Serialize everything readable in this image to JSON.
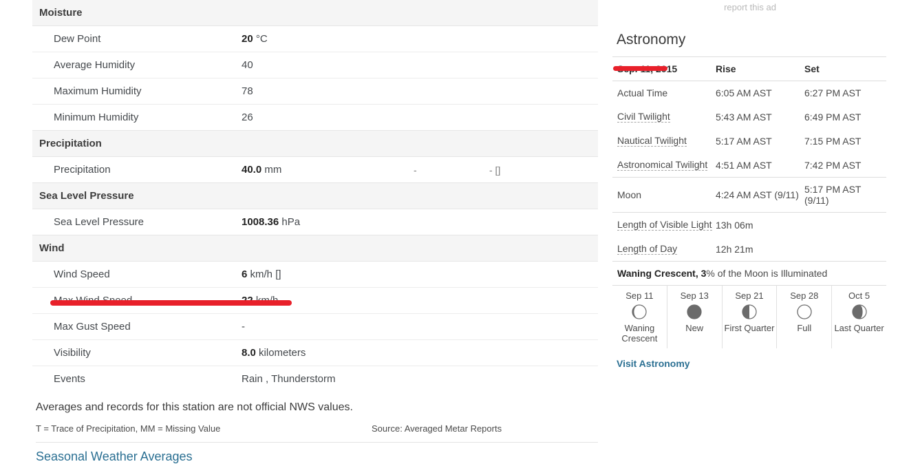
{
  "history": {
    "sections": [
      {
        "title": "Moisture",
        "rows": [
          {
            "label": "Dew Point",
            "num": "20",
            "unit": "°C",
            "x1": "",
            "x2": ""
          },
          {
            "label": "Average Humidity",
            "num": "",
            "unit": "40",
            "x1": "",
            "x2": ""
          },
          {
            "label": "Maximum Humidity",
            "num": "",
            "unit": "78",
            "x1": "",
            "x2": ""
          },
          {
            "label": "Minimum Humidity",
            "num": "",
            "unit": "26",
            "x1": "",
            "x2": ""
          }
        ]
      },
      {
        "title": "Precipitation",
        "rows": [
          {
            "label": "Precipitation",
            "num": "40.0",
            "unit": "mm",
            "x1": "-",
            "x2": "- []"
          }
        ]
      },
      {
        "title": "Sea Level Pressure",
        "rows": [
          {
            "label": "Sea Level Pressure",
            "num": "1008.36",
            "unit": "hPa",
            "x1": "",
            "x2": ""
          }
        ]
      },
      {
        "title": "Wind",
        "rows": [
          {
            "label": "Wind Speed",
            "num": "6",
            "unit": "km/h []",
            "x1": "",
            "x2": ""
          },
          {
            "label": "Max Wind Speed",
            "num": "22",
            "unit": "km/h",
            "x1": "",
            "x2": ""
          },
          {
            "label": "Max Gust Speed",
            "num": "",
            "unit": "-",
            "x1": "",
            "x2": ""
          },
          {
            "label": "Visibility",
            "num": "8.0",
            "unit": "kilometers",
            "x1": "",
            "x2": ""
          },
          {
            "label": "Events",
            "num": "",
            "unit": "Rain , Thunderstorm",
            "x1": "",
            "x2": ""
          }
        ]
      }
    ],
    "nws_note": "Averages and records for this station are not official NWS values.",
    "legend": "T = Trace of Precipitation, MM = Missing Value",
    "source": "Source: Averaged Metar Reports",
    "seasonal_link": "Seasonal Weather Averages"
  },
  "astronomy": {
    "report_ad": "report this ad",
    "title": "Astronomy",
    "columns": {
      "date": "Sep. 11, 2015",
      "rise": "Rise",
      "set": "Set"
    },
    "rows": [
      {
        "label": "Actual Time",
        "tip": false,
        "rise": "6:05 AM AST",
        "set": "6:27 PM AST"
      },
      {
        "label": "Civil Twilight",
        "tip": true,
        "rise": "5:43 AM AST",
        "set": "6:49 PM AST"
      },
      {
        "label": "Nautical Twilight",
        "tip": true,
        "rise": "5:17 AM AST",
        "set": "7:15 PM AST"
      },
      {
        "label": "Astronomical Twilight",
        "tip": true,
        "rise": "4:51 AM AST",
        "set": "7:42 PM AST"
      },
      {
        "label": "Moon",
        "tip": false,
        "rise": "4:24 AM AST (9/11)",
        "set": "5:17 PM AST (9/11)"
      },
      {
        "label": "Length of Visible Light",
        "tip": true,
        "rise": "13h 06m",
        "set": ""
      },
      {
        "label": "Length of Day",
        "tip": true,
        "rise": "12h 21m",
        "set": ""
      }
    ],
    "illumination": {
      "phase": "Waning Crescent,",
      "percent": "3",
      "suffix": "% of the Moon is Illuminated"
    },
    "phases": [
      {
        "date": "Sep 11",
        "name": "Waning Crescent",
        "icon": "waning-crescent-moon-icon"
      },
      {
        "date": "Sep 13",
        "name": "New",
        "icon": "new-moon-icon"
      },
      {
        "date": "Sep 21",
        "name": "First Quarter",
        "icon": "first-quarter-moon-icon"
      },
      {
        "date": "Sep 28",
        "name": "Full",
        "icon": "full-moon-icon"
      },
      {
        "date": "Oct 5",
        "name": "Last Quarter",
        "icon": "last-quarter-moon-icon"
      }
    ],
    "visit_link": "Visit Astronomy"
  },
  "annotations": {
    "color": "#e8202a",
    "marks": [
      {
        "name": "max-wind-speed-underline",
        "target": "Max Wind Speed"
      },
      {
        "name": "astronomy-date-underline",
        "target": "Sep. 11, 2015"
      }
    ]
  }
}
